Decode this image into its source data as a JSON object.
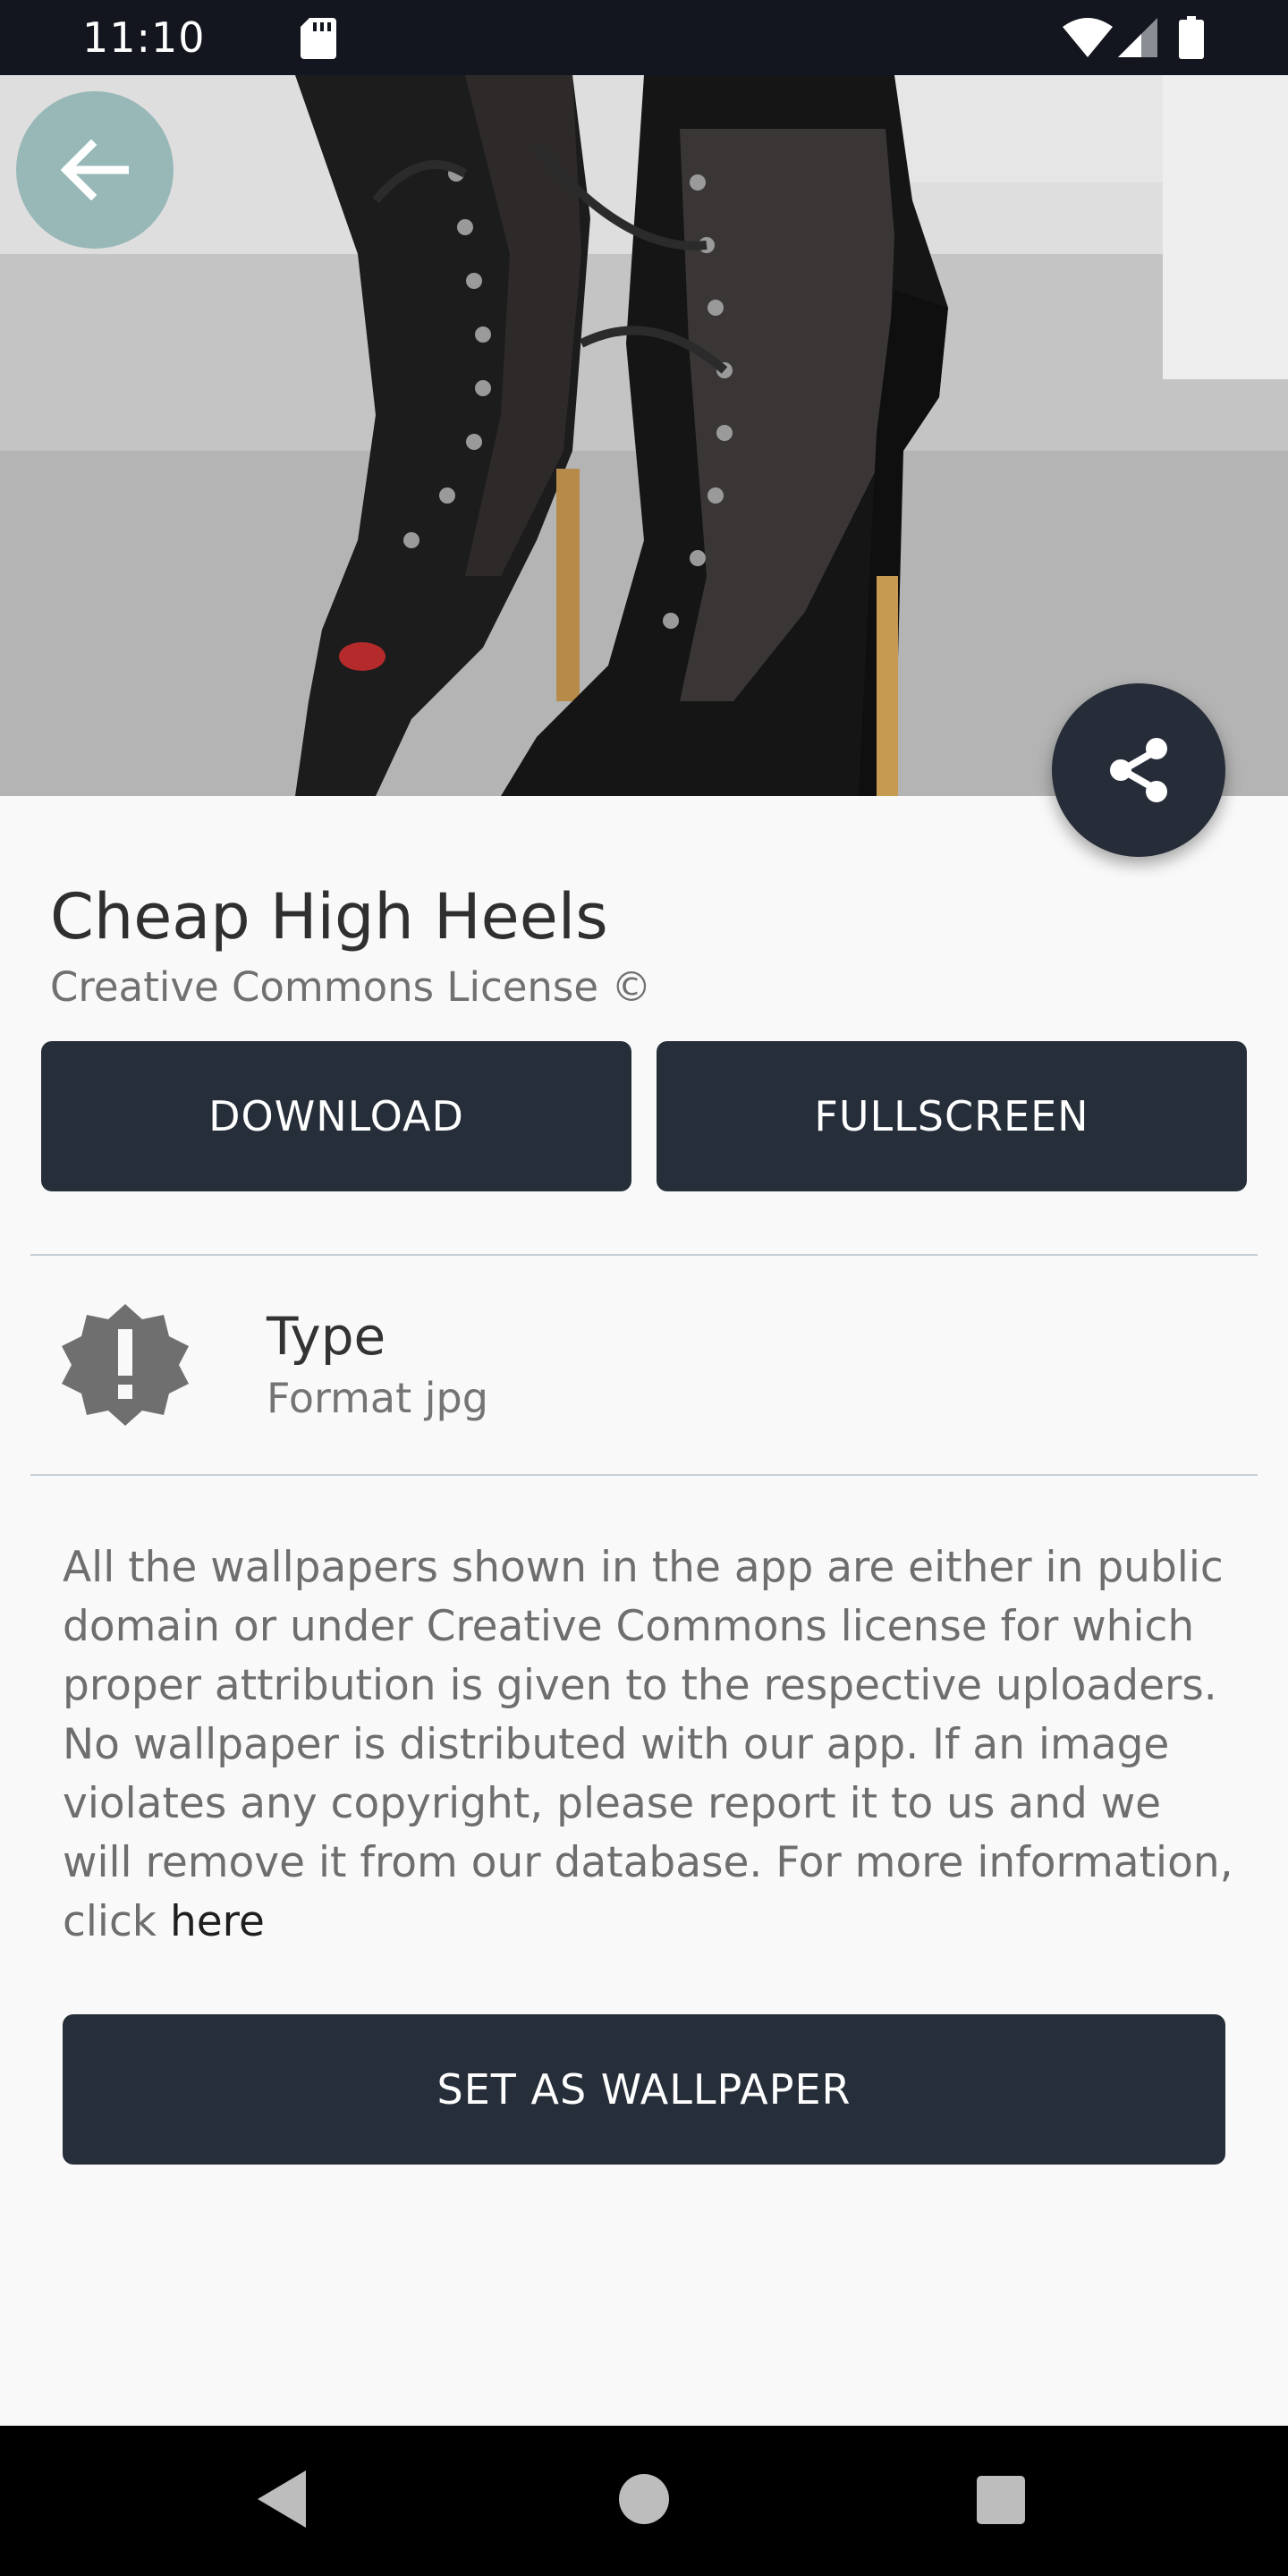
{
  "status_bar": {
    "time": "11:10",
    "icons": [
      "sd-card-icon",
      "wifi-icon",
      "cell-signal-icon",
      "battery-icon"
    ]
  },
  "hero": {
    "back_icon": "arrow-left-icon",
    "share_icon": "share-icon"
  },
  "wallpaper": {
    "title": "Cheap High Heels",
    "license": "Creative Commons License ©"
  },
  "actions": {
    "download_label": "DOWNLOAD",
    "fullscreen_label": "FULLSCREEN",
    "set_wallpaper_label": "SET AS WALLPAPER"
  },
  "details": {
    "icon": "alert-badge-icon",
    "type_label": "Type",
    "type_value": "Format jpg"
  },
  "disclaimer": {
    "text": "All the wallpapers shown in the app are either in public domain or under Creative Commons license for which proper attribution is given to the respective uploaders. No wallpaper is distributed with our app. If an image violates any copyright, please report it to us and we will remove it from our database. For more information, click ",
    "link": "here"
  },
  "nav_bar": {
    "icons": [
      "nav-back-icon",
      "nav-home-icon",
      "nav-recents-icon"
    ]
  },
  "colors": {
    "primary_dark": "#262e3a",
    "background": "#f9f9f9",
    "back_button_tint": "#8cb2b2"
  }
}
